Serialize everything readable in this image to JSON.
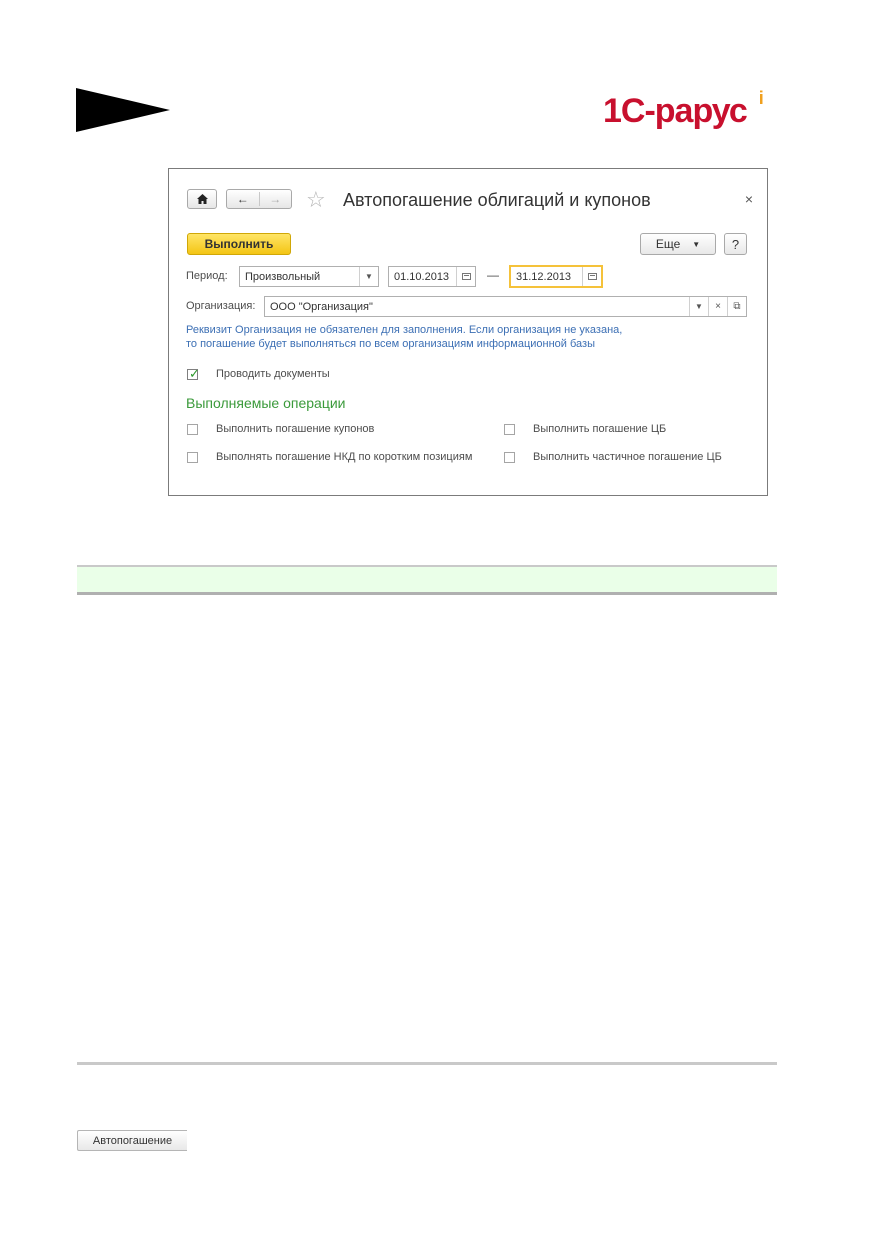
{
  "logo": {
    "text": "1С-рарус",
    "mark": "i"
  },
  "window": {
    "title": "Автопогашение облигаций и купонов",
    "home_icon": "home-icon",
    "back_icon": "←",
    "forward_icon": "→",
    "star_icon": "☆",
    "close_icon": "×"
  },
  "toolbar": {
    "run_label": "Выполнить",
    "more_label": "Еще",
    "more_arrow": "▼",
    "help_label": "?"
  },
  "period": {
    "label": "Период:",
    "type_value": "Произвольный",
    "start_date": "01.10.2013",
    "dash": "—",
    "end_date": "31.12.2013"
  },
  "organization": {
    "label": "Организация:",
    "value": "ООО \"Организация\""
  },
  "note": {
    "line1": "Реквизит Организация не обязателен для заполнения. Если организация не указана,",
    "line2": "то погашение будет выполняться по всем организациям информационной базы"
  },
  "post_documents": {
    "label": "Проводить документы",
    "checked": true
  },
  "operations": {
    "title": "Выполняемые операции",
    "items": [
      {
        "label": "Выполнить погашение купонов",
        "checked": false
      },
      {
        "label": "Выполнить погашение ЦБ",
        "checked": false
      },
      {
        "label": "Выполнять погашение НКД по коротким позициям",
        "checked": false
      },
      {
        "label": "Выполнить частичное погашение ЦБ",
        "checked": false
      }
    ]
  },
  "bottom": {
    "button_label": "Автопогашение"
  },
  "colors": {
    "accent_yellow": "#f3c515",
    "focus_border": "#f5c23a",
    "section_green": "#3b9a3b",
    "note_blue": "#3c6fb4",
    "bar_green": "#eaffe8",
    "logo_red": "#c8102e"
  }
}
